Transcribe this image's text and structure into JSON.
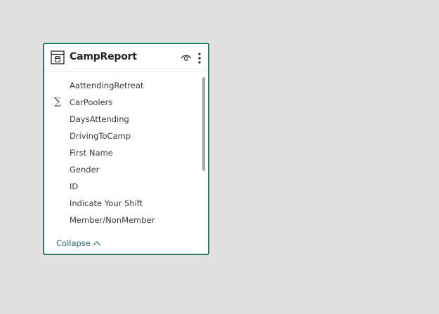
{
  "table": {
    "title": "CampReport",
    "fields": [
      {
        "label": "AattendingRetreat",
        "icon": ""
      },
      {
        "label": "CarPoolers",
        "icon": "∑"
      },
      {
        "label": "DaysAttending",
        "icon": ""
      },
      {
        "label": "DrivingToCamp",
        "icon": ""
      },
      {
        "label": "First Name",
        "icon": ""
      },
      {
        "label": "Gender",
        "icon": ""
      },
      {
        "label": "ID",
        "icon": ""
      },
      {
        "label": "Indicate Your Shift",
        "icon": ""
      },
      {
        "label": "Member/NonMember",
        "icon": ""
      }
    ],
    "collapse_label": "Collapse"
  },
  "icons": {
    "table": "table-icon",
    "visibility": "eye-icon",
    "more": "more-options-icon",
    "sum": "sigma-icon",
    "collapse": "chevron-up-icon"
  },
  "colors": {
    "background": "#e1e0df",
    "card_border": "#1f7a67",
    "link": "#1f6b7a",
    "text": "#3b3a39"
  }
}
